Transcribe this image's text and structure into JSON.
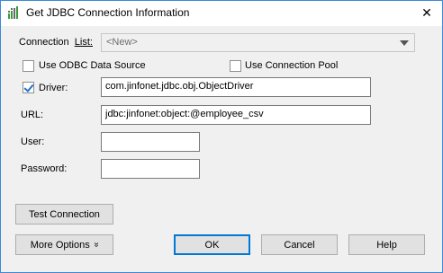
{
  "dialog": {
    "title": "Get JDBC Connection Information",
    "close_label": "✕"
  },
  "connection_list": {
    "label_prefix": "Connection",
    "label_suffix": "List:",
    "selected": "<New>"
  },
  "options": {
    "odbc_label": "Use ODBC Data Source",
    "odbc_checked": false,
    "pool_label": "Use Connection Pool",
    "pool_checked": false
  },
  "driver": {
    "label": "Driver:",
    "checked": true,
    "value": "com.jinfonet.jdbc.obj.ObjectDriver"
  },
  "url": {
    "label": "URL:",
    "value": "jdbc:jinfonet:object:@employee_csv"
  },
  "user": {
    "label": "User:",
    "value": ""
  },
  "password": {
    "label": "Password:",
    "value": ""
  },
  "buttons": {
    "test_connection": "Test Connection",
    "more_options": "More Options",
    "more_options_icon": "»",
    "ok": "OK",
    "cancel": "Cancel",
    "help": "Help"
  },
  "colors": {
    "accent": "#0078d7",
    "window_border": "#3c8ad6",
    "icon_green": "#3a9b3a"
  }
}
